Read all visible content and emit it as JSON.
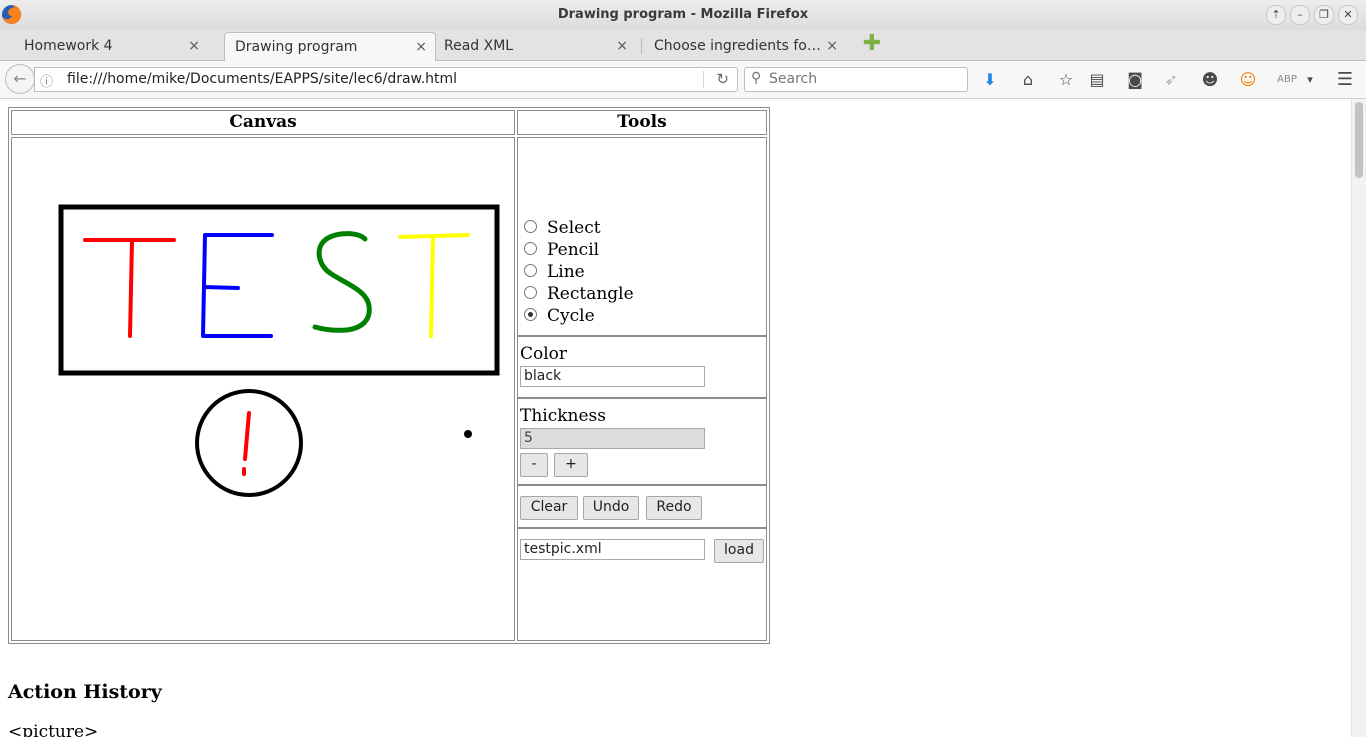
{
  "window": {
    "title": "Drawing program - Mozilla Firefox"
  },
  "tabs": [
    {
      "label": "Homework 4",
      "close": "×"
    },
    {
      "label": "Drawing program",
      "close": "×"
    },
    {
      "label": "Read XML",
      "close": "×"
    },
    {
      "label": "Choose ingredients for …",
      "close": "×"
    }
  ],
  "navbar": {
    "url": "file:///home/mike/Documents/EAPPS/site/lec6/draw.html",
    "search_placeholder": "Search"
  },
  "page": {
    "canvas_header": "Canvas",
    "tools_header": "Tools",
    "tools": [
      "Select",
      "Pencil",
      "Line",
      "Rectangle",
      "Cycle"
    ],
    "selected_tool": "Cycle",
    "color_label": "Color",
    "color_value": "black",
    "thickness_label": "Thickness",
    "thickness_value": "5",
    "minus_label": "-",
    "plus_label": "+",
    "clear_label": "Clear",
    "undo_label": "Undo",
    "redo_label": "Redo",
    "file_value": "testpic.xml",
    "load_label": "load",
    "history_title": "Action History",
    "history_first_line": "<picture>"
  },
  "drawing": {
    "text": "TEST",
    "exclamation": "!",
    "letter_colors": [
      "#ff0000",
      "#0000ff",
      "#008000",
      "#ffff00"
    ],
    "outline_color": "#000000"
  }
}
